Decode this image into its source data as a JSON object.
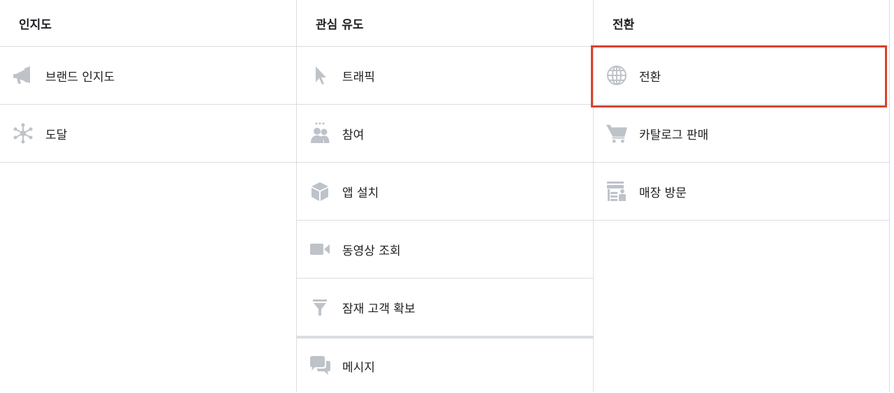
{
  "columns": [
    {
      "header": "인지도",
      "options": [
        {
          "label": "브랜드 인지도",
          "icon": "megaphone-icon"
        },
        {
          "label": "도달",
          "icon": "reach-icon"
        }
      ]
    },
    {
      "header": "관심 유도",
      "options": [
        {
          "label": "트래픽",
          "icon": "cursor-icon"
        },
        {
          "label": "참여",
          "icon": "people-icon"
        },
        {
          "label": "앱 설치",
          "icon": "box-icon"
        },
        {
          "label": "동영상 조회",
          "icon": "video-camera-icon"
        },
        {
          "label": "잠재 고객 확보",
          "icon": "funnel-icon"
        },
        {
          "label": "메시지",
          "icon": "chat-bubbles-icon"
        }
      ]
    },
    {
      "header": "전환",
      "options": [
        {
          "label": "전환",
          "icon": "globe-icon",
          "selected": true
        },
        {
          "label": "카탈로그 판매",
          "icon": "shopping-cart-icon"
        },
        {
          "label": "매장 방문",
          "icon": "store-icon"
        }
      ]
    }
  ],
  "colors": {
    "icon": "#bec3c9",
    "border": "#dadde1",
    "highlight": "#d9432c",
    "text": "#1c1e21"
  }
}
